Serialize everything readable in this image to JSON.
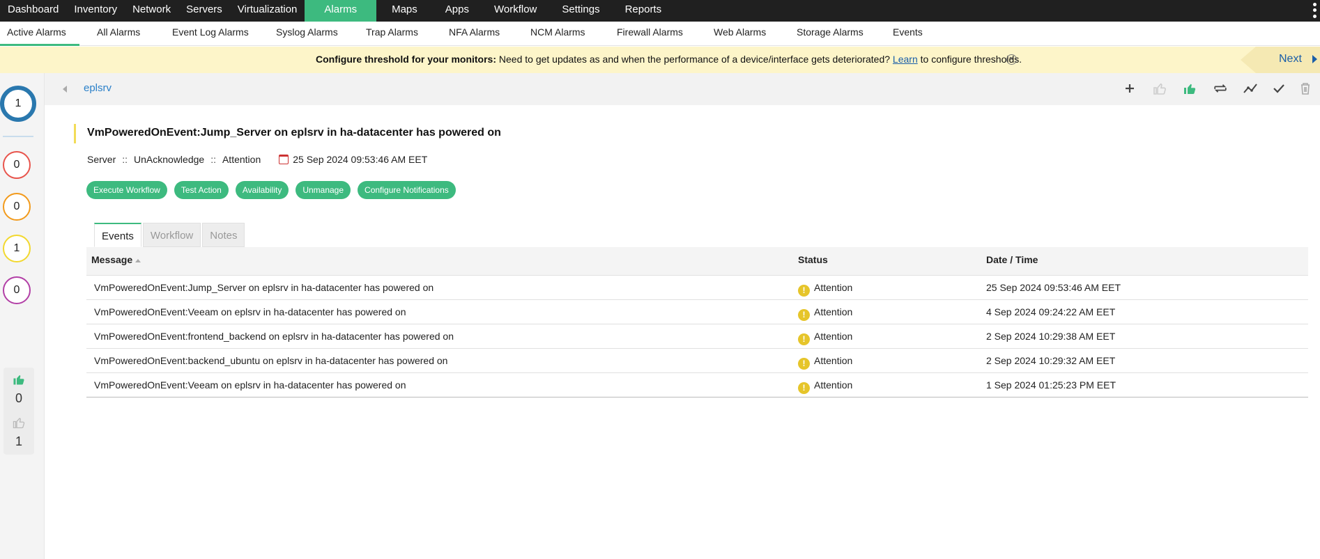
{
  "top_nav": {
    "items": [
      "Dashboard",
      "Inventory",
      "Network",
      "Servers",
      "Virtualization",
      "Alarms",
      "Maps",
      "Apps",
      "Workflow",
      "Settings",
      "Reports"
    ],
    "active": "Alarms"
  },
  "sub_nav": {
    "items": [
      "Active Alarms",
      "All Alarms",
      "Event Log Alarms",
      "Syslog Alarms",
      "Trap Alarms",
      "NFA Alarms",
      "NCM Alarms",
      "Firewall Alarms",
      "Web Alarms",
      "Storage Alarms",
      "Events"
    ],
    "active": "Active Alarms"
  },
  "banner": {
    "bold": "Configure threshold for your monitors:",
    "text": " Need to get updates as and when the performance of a device/interface gets deteriorated? ",
    "link": "Learn",
    "tail": " to configure thresholds.",
    "next": "Next"
  },
  "left_rail": {
    "counts": [
      "1",
      "0",
      "0",
      "1",
      "0"
    ],
    "count_colors": [
      "#2a78ae",
      "#e8544c",
      "#f29a1b",
      "#f2d82e",
      "#b23fa6"
    ],
    "thumbs_up": "0",
    "thumbs_down": "1"
  },
  "breadcrumb": {
    "label": "eplsrv"
  },
  "alarm": {
    "title": "VmPoweredOnEvent:Jump_Server on eplsrv in ha-datacenter has powered on",
    "category": "Server",
    "ack_state": "UnAcknowledge",
    "severity": "Attention",
    "separator": "::",
    "datetime": "25 Sep 2024 09:53:46 AM EET"
  },
  "actions": [
    "Execute Workflow",
    "Test Action",
    "Availability",
    "Unmanage",
    "Configure Notifications"
  ],
  "tabs": {
    "items": [
      "Events",
      "Workflow",
      "Notes"
    ],
    "active": "Events"
  },
  "table": {
    "headers": [
      "Message",
      "Status",
      "Date / Time"
    ],
    "rows": [
      [
        "VmPoweredOnEvent:Jump_Server on eplsrv in ha-datacenter has powered on",
        "Attention",
        "25 Sep 2024 09:53:46 AM EET"
      ],
      [
        "VmPoweredOnEvent:Veeam on eplsrv in ha-datacenter has powered on",
        "Attention",
        "4 Sep 2024 09:24:22 AM EET"
      ],
      [
        "VmPoweredOnEvent:frontend_backend on eplsrv in ha-datacenter has powered on",
        "Attention",
        "2 Sep 2024 10:29:38 AM EET"
      ],
      [
        "VmPoweredOnEvent:backend_ubuntu on eplsrv in ha-datacenter has powered on",
        "Attention",
        "2 Sep 2024 10:29:32 AM EET"
      ],
      [
        "VmPoweredOnEvent:Veeam on eplsrv in ha-datacenter has powered on",
        "Attention",
        "1 Sep 2024 01:25:23 PM EET"
      ]
    ]
  },
  "colors": {
    "accent": "#3dba7f",
    "nav_bg": "#202020",
    "banner_bg": "#fdf5c9",
    "link": "#2b80c9",
    "warning": "#e6c52a"
  }
}
